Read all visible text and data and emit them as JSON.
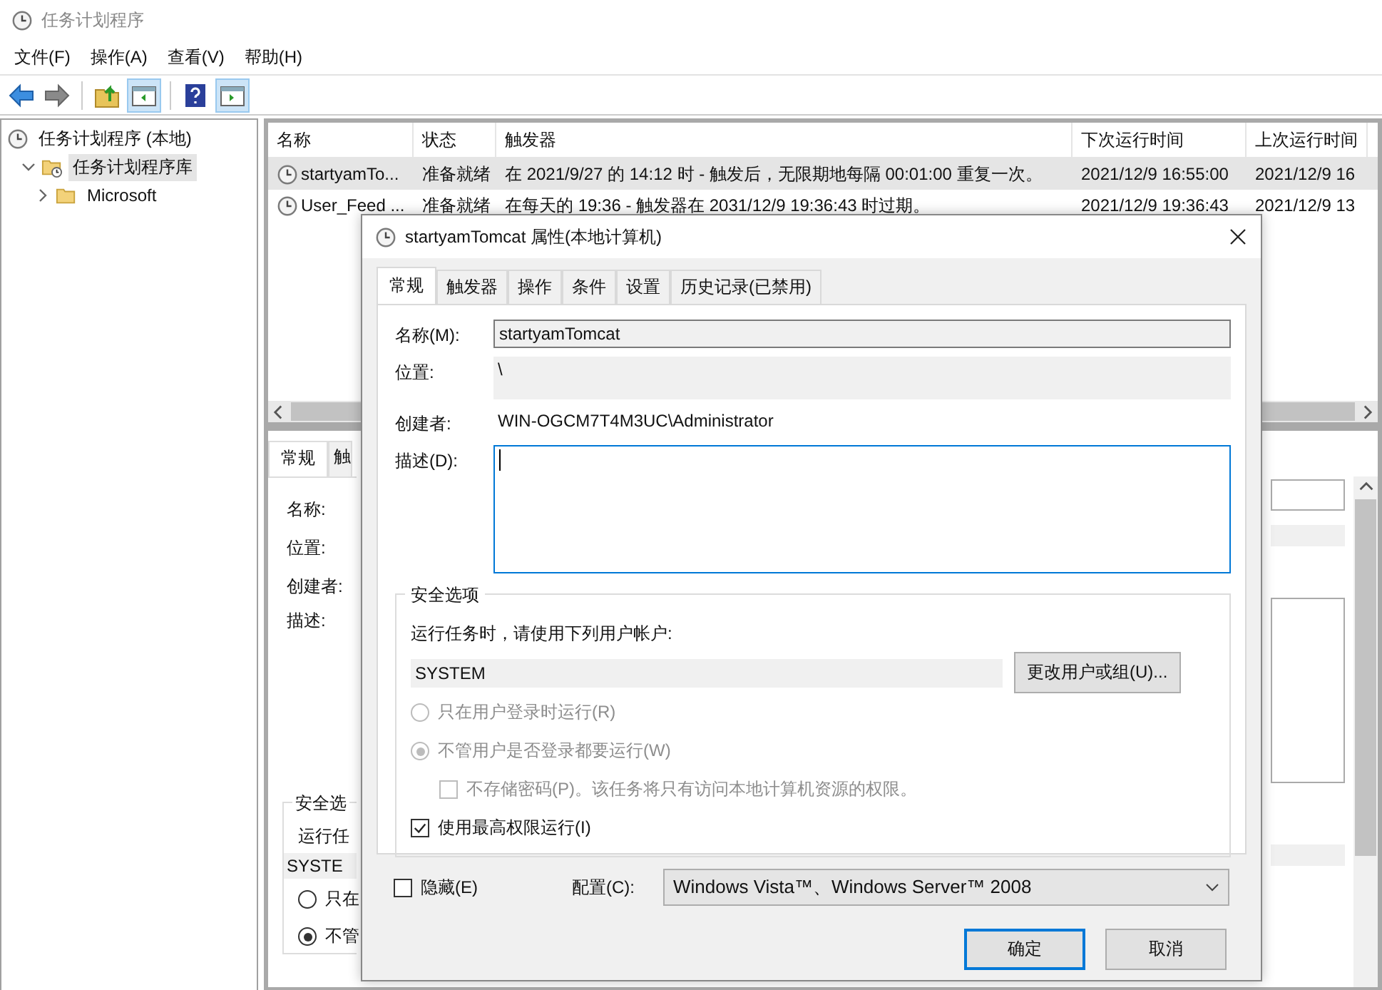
{
  "window": {
    "title": "任务计划程序"
  },
  "menu": [
    "文件(F)",
    "操作(A)",
    "查看(V)",
    "帮助(H)"
  ],
  "tree": [
    {
      "label": "任务计划程序 (本地)",
      "selected": false,
      "children": [
        {
          "label": "任务计划程序库",
          "selected": true,
          "expanded": true,
          "children": [
            {
              "label": "Microsoft",
              "selected": false,
              "expanded": false
            }
          ]
        }
      ]
    }
  ],
  "task_list": {
    "columns": [
      "名称",
      "状态",
      "触发器",
      "下次运行时间",
      "上次运行时间"
    ],
    "rows": [
      {
        "selected": true,
        "cells": [
          "startyamTo...",
          "准备就绪",
          "在 2021/9/27 的 14:12 时 - 触发后，无限期地每隔 00:01:00 重复一次。",
          "2021/12/9 16:55:00",
          "2021/12/9 16"
        ]
      },
      {
        "selected": false,
        "cells": [
          "User_Feed ...",
          "准备就绪",
          "在每天的 19:36 - 触发器在 2031/12/9 19:36:43 时过期。",
          "2021/12/9 19:36:43",
          "2021/12/9 13"
        ]
      }
    ]
  },
  "details_pane": {
    "tabs": [
      {
        "label": "常规",
        "selected": true
      },
      {
        "label": "触",
        "selected": false
      }
    ],
    "labels": [
      "名称:",
      "位置:",
      "创建者:",
      "描述:"
    ],
    "security_group": "安全选",
    "security_text": "运行任",
    "account": "SYSTE",
    "radios": [
      {
        "label": "只在",
        "selected": false
      },
      {
        "label": "不管",
        "selected": true
      }
    ]
  },
  "dialog": {
    "title": "startyamTomcat 属性(本地计算机)",
    "tabs": [
      {
        "label": "常规",
        "selected": true
      },
      {
        "label": "触发器",
        "selected": false
      },
      {
        "label": "操作",
        "selected": false
      },
      {
        "label": "条件",
        "selected": false
      },
      {
        "label": "设置",
        "selected": false
      },
      {
        "label": "历史记录(已禁用)",
        "selected": false
      }
    ],
    "name_label": "名称(M):",
    "name_value": "startyamTomcat",
    "location_label": "位置:",
    "location_value": "\\",
    "author_label": "创建者:",
    "author_value": "WIN-OGCM7T4M3UC\\Administrator",
    "description_label": "描述(D):",
    "security": {
      "title": "安全选项",
      "account_prompt": "运行任务时，请使用下列用户帐户:",
      "account": "SYSTEM",
      "change_button": "更改用户或组(U)...",
      "options": [
        {
          "kind": "radio",
          "label": "只在用户登录时运行(R)",
          "selected": false,
          "disabled": true,
          "indent": false
        },
        {
          "kind": "radio",
          "label": "不管用户是否登录都要运行(W)",
          "selected": true,
          "disabled": true,
          "indent": false
        },
        {
          "kind": "checkbox",
          "label": "不存储密码(P)。该任务将只有访问本地计算机资源的权限。",
          "checked": false,
          "disabled": true,
          "indent": true
        },
        {
          "kind": "checkbox",
          "label": "使用最高权限运行(I)",
          "checked": true,
          "disabled": false,
          "indent": false
        }
      ]
    },
    "hidden": {
      "label": "隐藏(E)",
      "checked": false
    },
    "config_label": "配置(C):",
    "config_value": "Windows Vista™、Windows Server™ 2008",
    "buttons": [
      "确定",
      "取消"
    ]
  }
}
